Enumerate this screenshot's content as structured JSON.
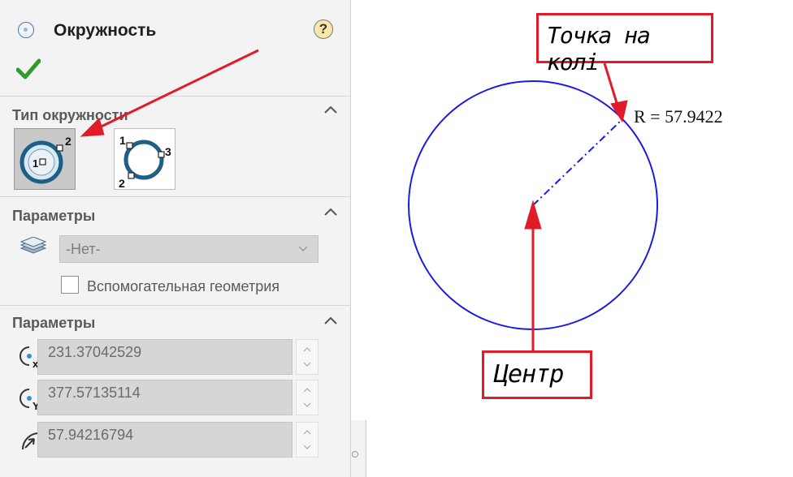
{
  "feature_panel": {
    "title": "Окружность",
    "help_symbol": "?",
    "ok_icon": "check-icon",
    "circle_type_section": {
      "title": "Тип окружности",
      "options": [
        {
          "name": "center-radius",
          "active": true,
          "labels": [
            "1",
            "2"
          ]
        },
        {
          "name": "perimeter-3-points",
          "active": false,
          "labels": [
            "1",
            "2",
            "3"
          ]
        }
      ]
    },
    "options_section": {
      "title": "Параметры",
      "layer_value": "-Нет-",
      "construction_geometry_label": "Вспомогательная геометрия",
      "construction_geometry_checked": false
    },
    "parameters_section": {
      "title": "Параметры",
      "center_x": "231.37042529",
      "center_y": "377.57135114",
      "radius": "57.94216794"
    }
  },
  "annotations": {
    "point_on_circle_label": "Точка на колі",
    "center_label": "Центр",
    "radius_dimension": "R = 57.9422"
  },
  "colors": {
    "circle": "#1a1ae6",
    "callout_red": "#e21b2b",
    "accent_check": "#2e9b2e"
  }
}
